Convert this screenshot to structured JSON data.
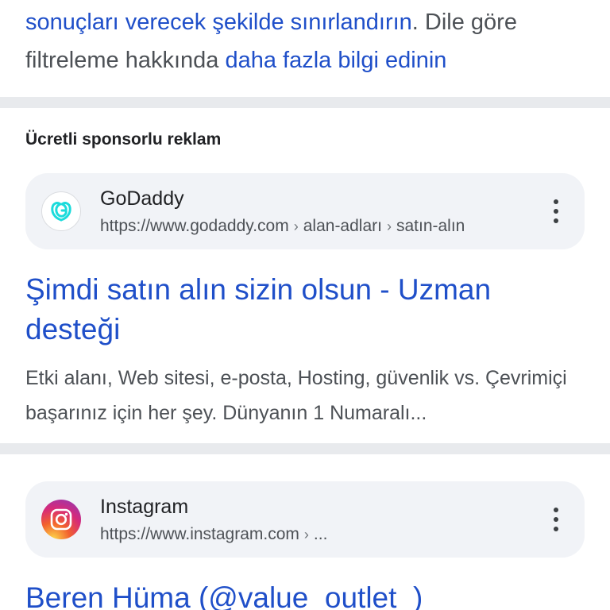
{
  "top_text": {
    "link1": "sonuçları verecek şekilde sınırlandırın",
    "text_mid": ". Dile göre filtreleme hakkında ",
    "link2": "daha fazla bilgi edinin"
  },
  "sponsored_heading": "Ücretli sponsorlu reklam",
  "ad": {
    "site_name": "GoDaddy",
    "url": "https://www.godaddy.com",
    "breadcrumbs": [
      "alan-adları",
      "satın-alın"
    ],
    "separator": "›",
    "title": "Şimdi satın alın sizin olsun - Uzman desteği",
    "snippet": "Etki alanı, Web sitesi, e-posta, Hosting, güvenlik vs. Çevrimiçi başarınız için her şey. Dünyanın 1 Numaralı...",
    "icon": "godaddy-logo-icon",
    "brand_color": "#1bdbdb"
  },
  "result2": {
    "site_name": "Instagram",
    "url": "https://www.instagram.com",
    "separator": "›",
    "ellipsis": "...",
    "title": "Beren Hüma (@value_outlet_)",
    "icon": "instagram-logo-icon"
  },
  "colors": {
    "link": "#1f4fc9",
    "text": "#4d5156",
    "divider": "#e8eaed",
    "chip_bg": "#f1f3f7"
  }
}
